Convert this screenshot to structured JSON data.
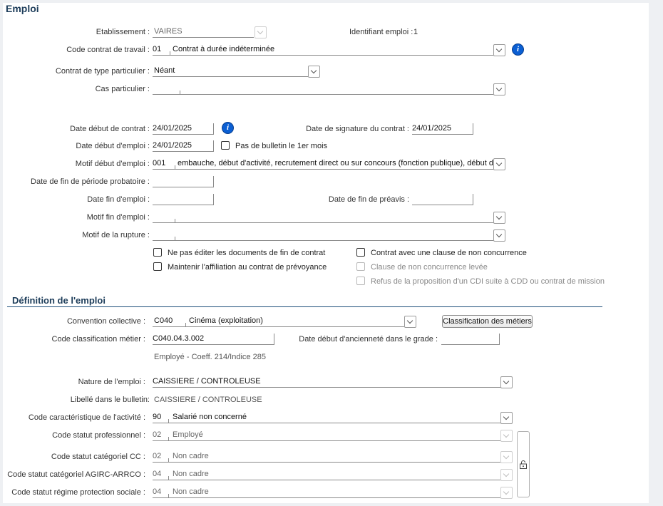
{
  "section_emploi": {
    "title": "Emploi"
  },
  "etablissement": {
    "label": "Etablissement :",
    "value": "VAIRES"
  },
  "identifiant": {
    "label": "Identifiant emploi :",
    "value": "1"
  },
  "code_contrat": {
    "label": "Code contrat de travail :",
    "code": "01",
    "text": "Contrat à durée indéterminée"
  },
  "contrat_particulier": {
    "label": "Contrat de type particulier :",
    "value": "Néant"
  },
  "cas_particulier": {
    "label": "Cas particulier :",
    "value": ""
  },
  "date_debut_contrat": {
    "label": "Date début de contrat :",
    "value": "24/01/2025"
  },
  "date_signature": {
    "label": "Date de signature du contrat :",
    "value": "24/01/2025"
  },
  "date_debut_emploi": {
    "label": "Date début d'emploi :",
    "value": "24/01/2025"
  },
  "pas_bulletin": {
    "label": "Pas de bulletin le 1er mois",
    "checked": false
  },
  "motif_debut": {
    "label": "Motif début d'emploi :",
    "code": "001",
    "text": "embauche, début d'activité, recrutement direct ou sur concours (fonction publique), début de c"
  },
  "fin_probatoire": {
    "label": "Date de fin de période probatoire :",
    "value": ""
  },
  "date_fin_emploi": {
    "label": "Date fin d'emploi :",
    "value": ""
  },
  "date_fin_preavis": {
    "label": "Date de fin de préavis :",
    "value": ""
  },
  "motif_fin": {
    "label": "Motif fin d'emploi :",
    "value": ""
  },
  "motif_rupture": {
    "label": "Motif de la rupture :",
    "value": ""
  },
  "checkboxes": {
    "ne_pas_editer": "Ne pas éditer les documents de fin de contrat",
    "maintenir": "Maintenir l'affiliation au contrat de prévoyance",
    "clause_non_concurrence": "Contrat avec une clause de non concurrence",
    "clause_levee": "Clause de non concurrence levée",
    "refus_cdi": "Refus de la proposition d'un CDI suite à CDD ou contrat de mission"
  },
  "section_definition": {
    "title": "Définition de l'emploi"
  },
  "convention": {
    "label": "Convention collective :",
    "code": "C040",
    "text": "Cinéma (exploitation)"
  },
  "classification_button": "Classification des métiers",
  "code_classification": {
    "label": "Code classification métier :",
    "value": "C040.04.3.002"
  },
  "date_anciennete": {
    "label": "Date début d'ancienneté dans le grade :",
    "value": ""
  },
  "classification_detail": "Employé - Coeff. 214/Indice 285",
  "nature_emploi": {
    "label": "Nature de l'emploi :",
    "value": "CAISSIERE / CONTROLEUSE"
  },
  "libelle_bulletin": {
    "label": "Libellé dans le bulletin:",
    "value": "CAISSIERE / CONTROLEUSE"
  },
  "code_caracteristique": {
    "label": "Code caractéristique de l'activité :",
    "code": "90",
    "text": "Salarié non concerné"
  },
  "statut_pro": {
    "label": "Code statut professionnel :",
    "code": "02",
    "text": "Employé"
  },
  "statut_cc": {
    "label": "Code statut catégoriel CC :",
    "code": "02",
    "text": "Non cadre"
  },
  "statut_agirc": {
    "label": "Code statut catégoriel AGIRC-ARRCO :",
    "code": "04",
    "text": "Non cadre"
  },
  "statut_protection": {
    "label": "Code statut régime protection sociale :",
    "code": "04",
    "text": "Non cadre"
  }
}
